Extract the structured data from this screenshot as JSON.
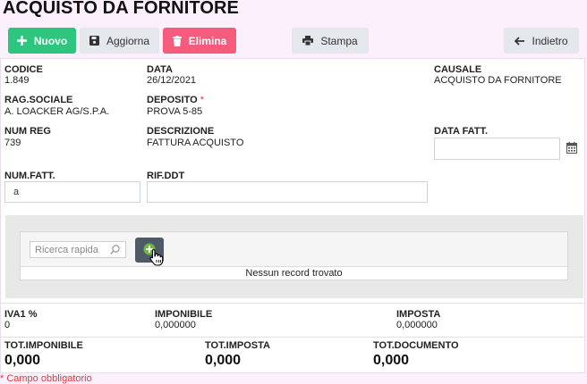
{
  "page": {
    "title": "ACQUISTO DA FORNITORE"
  },
  "toolbar": {
    "new_label": "Nuovo",
    "refresh_label": "Aggiorna",
    "delete_label": "Elimina",
    "print_label": "Stampa",
    "back_label": "Indietro"
  },
  "header": {
    "codice": {
      "label": "CODICE",
      "value": "1.849"
    },
    "data": {
      "label": "DATA",
      "value": "26/12/2021"
    },
    "causale": {
      "label": "CAUSALE",
      "value": "ACQUISTO DA FORNITORE"
    },
    "rag_sociale": {
      "label": "RAG.SOCIALE",
      "value": "A. LOACKER AG/S.P.A."
    },
    "deposito": {
      "label": "DEPOSITO",
      "required": "*",
      "value": "PROVA 5-85"
    },
    "num_reg": {
      "label": "NUM REG",
      "value": "739"
    },
    "descrizione": {
      "label": "DESCRIZIONE",
      "value": "FATTURA ACQUISTO"
    },
    "data_fatt": {
      "label": "DATA FATT.",
      "value": ""
    },
    "num_fatt": {
      "label": "NUM.FATT.",
      "value": "a"
    },
    "rif_ddt": {
      "label": "RIF.DDT",
      "value": ""
    }
  },
  "grid": {
    "search_placeholder": "Ricerca rapida",
    "empty_message": "Nessun record trovato"
  },
  "vat": {
    "iva": {
      "label": "IVA1 %",
      "value": "0"
    },
    "imponibile": {
      "label": "IMPONIBILE",
      "value": "0,000000"
    },
    "imposta": {
      "label": "IMPOSTA",
      "value": "0,000000"
    }
  },
  "totals": {
    "tot_imponibile": {
      "label": "TOT.IMPONIBILE",
      "value": "0,000"
    },
    "tot_imposta": {
      "label": "TOT.IMPOSTA",
      "value": "0,000"
    },
    "tot_documento": {
      "label": "TOT.DOCUMENTO",
      "value": "0,000"
    }
  },
  "footer": {
    "required_note": "* Campo obbligatorio"
  },
  "colors": {
    "primary_green": "#2ec67f",
    "danger_red": "#f55b7d",
    "neutral_button": "#e4e7ec",
    "page_background": "#fbf0fb",
    "required_red": "#e23a3a"
  },
  "icons": {
    "new": "plus-icon",
    "refresh": "save-icon",
    "delete": "trash-icon",
    "print": "printer-icon",
    "back": "arrow-left-icon",
    "calendar": "calendar-icon",
    "search": "search-icon",
    "add": "add-circle-icon",
    "cursor": "hand-pointer-icon"
  }
}
